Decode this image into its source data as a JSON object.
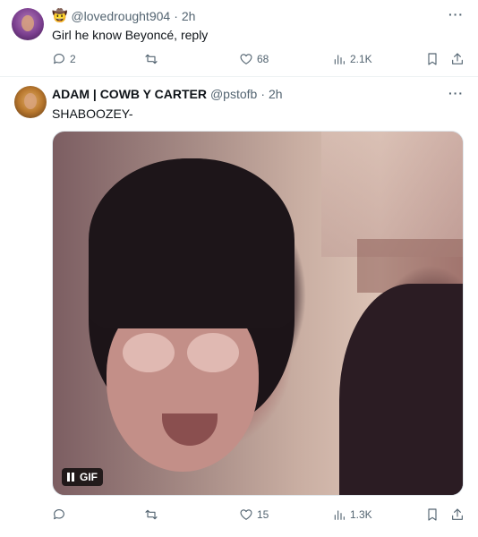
{
  "tweets": [
    {
      "emoji": "🤠",
      "handle": "@lovedrought904",
      "time": "2h",
      "text": "Girl he know Beyoncé, reply",
      "more": "···",
      "replies": "2",
      "retweets": "",
      "likes": "68",
      "views": "2.1K"
    },
    {
      "name": "ADAM | COWB  Y CARTER",
      "handle": "@pstofb",
      "time": "2h",
      "text": "SHABOOZEY-",
      "more": "···",
      "media_badge": "GIF",
      "replies": "",
      "retweets": "",
      "likes": "15",
      "views": "1.3K"
    }
  ],
  "separator": "·",
  "icons": [
    "reply-icon",
    "retweet-icon",
    "like-icon",
    "views-icon",
    "bookmark-icon",
    "share-icon",
    "pause-icon"
  ],
  "colors": {
    "secondary_text": "#536471",
    "primary_text": "#0f1419",
    "divider": "#eff3f4"
  }
}
